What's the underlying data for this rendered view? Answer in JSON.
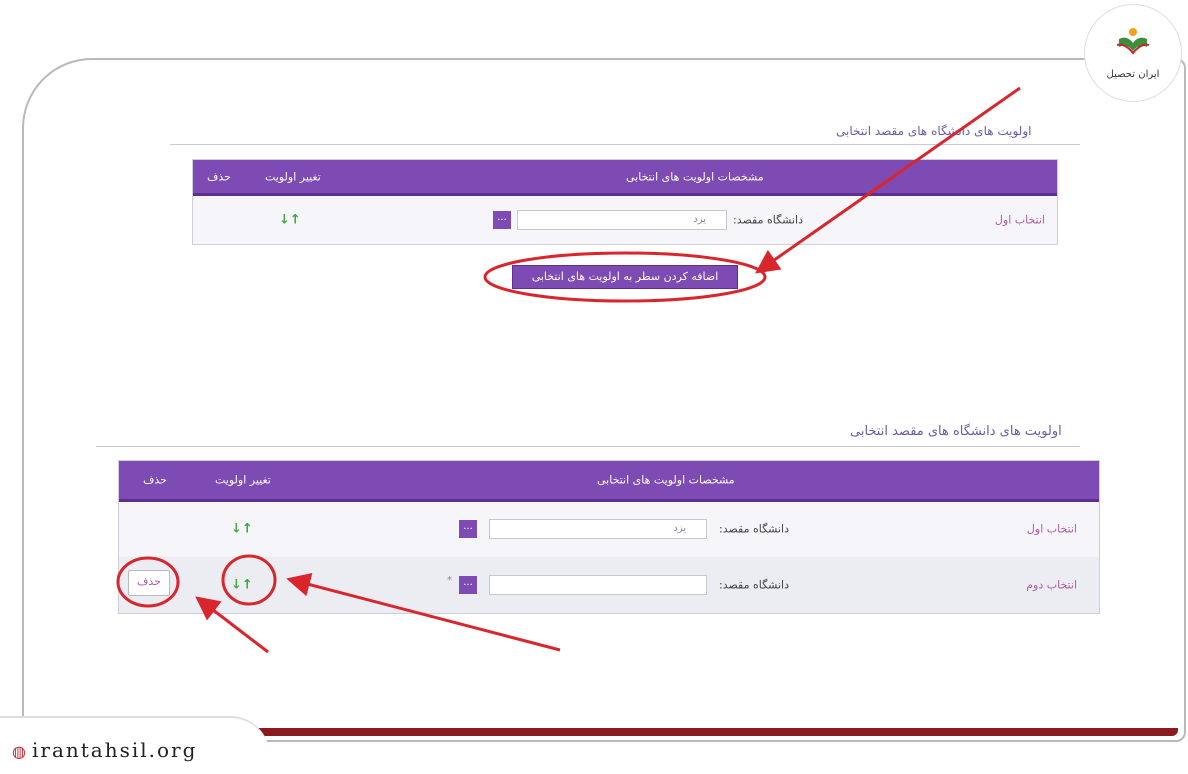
{
  "brand": {
    "logo_text": "ایران تحصیل",
    "website": "irantahsil.org"
  },
  "top": {
    "section_title": "اولویت های دانشگاه های مقصد انتخابی",
    "table": {
      "header": {
        "details": "مشخصات اولویت های انتخابی",
        "change_priority": "تغییر اولویت",
        "delete": "حذف"
      },
      "rows": [
        {
          "choice": "انتخاب اول",
          "dest_label": "دانشگاه مقصد:",
          "value": "یزد",
          "lookup": "..."
        }
      ]
    },
    "add_button": "اضافه کردن سطر به اولویت های انتخابی"
  },
  "bottom": {
    "section_title": "اولویت های دانشگاه های مقصد انتخابی",
    "table": {
      "header": {
        "details": "مشخصات اولویت های انتخابی",
        "change_priority": "تغییر اولویت",
        "delete": "حذف"
      },
      "rows": [
        {
          "choice": "انتخاب اول",
          "dest_label": "دانشگاه مقصد:",
          "value": "یزد",
          "lookup": "..."
        },
        {
          "choice": "انتخاب دوم",
          "dest_label": "دانشگاه مقصد:",
          "value": "",
          "lookup": "...",
          "required": "*",
          "delete_button": "حذف"
        }
      ]
    }
  },
  "icons": {
    "down": "arrow-down-green",
    "up": "arrow-up-green",
    "globe": "globe-icon"
  },
  "colors": {
    "header": "#7e4ab3",
    "annotation": "#d9262c",
    "footer_bar": "#8b1a1f"
  }
}
